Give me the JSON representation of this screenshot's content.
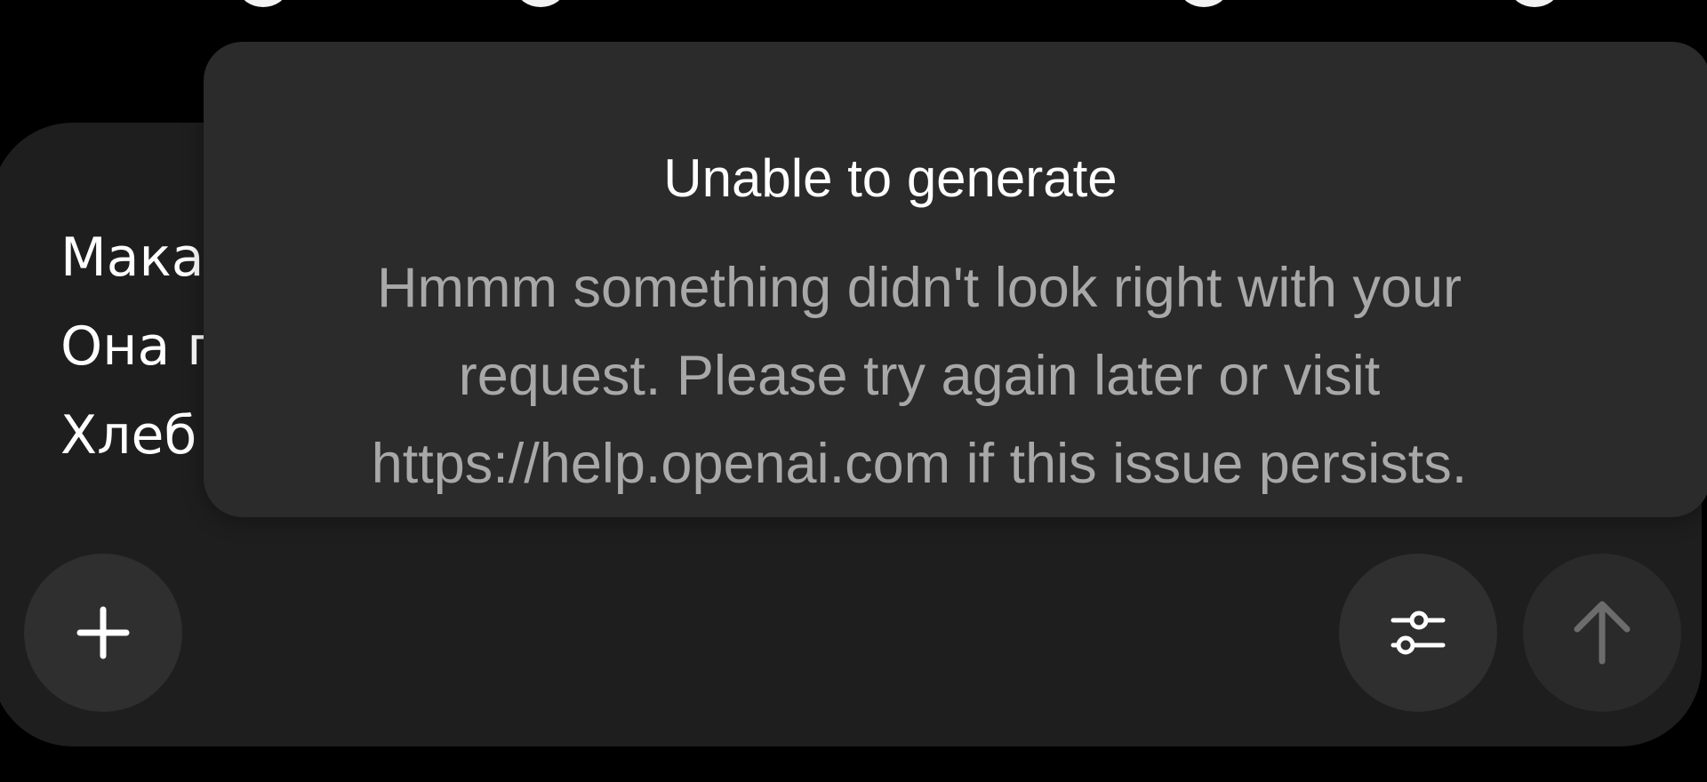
{
  "composer": {
    "lines": [
      "Мака",
      "Она п",
      "Хлеб"
    ]
  },
  "dialog": {
    "title": "Unable to generate",
    "message": "Hmmm something didn't look right with your request. Please try again later or visit https://help.openai.com if this issue persists."
  },
  "toolbar": {
    "attach_icon": "plus-icon",
    "settings_icon": "sliders-icon",
    "send_icon": "arrow-up-icon"
  },
  "colors": {
    "background": "#000000",
    "composer": "#1e1e1e",
    "dialog": "#2b2b2b",
    "button": "#2f2f2f",
    "title_text": "#ffffff",
    "message_text": "#a8a8a8"
  }
}
